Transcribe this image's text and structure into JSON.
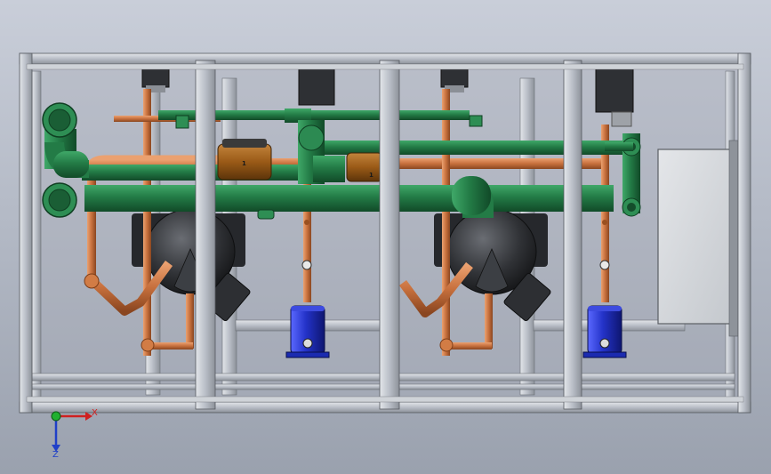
{
  "colors": {
    "frame": "#b9bec7",
    "frame_edge": "#55595f",
    "green_pipe": "#237b46",
    "copper_pipe": "#c7703d",
    "receiver_blue": "#2332c8",
    "compressor_dark": "#2d2f33",
    "accumulator_brown": "#9a5a17",
    "panel": "#d5d8dc",
    "axis_x": "#d02020",
    "axis_y": "#20b030",
    "axis_z": "#2040c8"
  },
  "axis_triad": {
    "x_label": "X",
    "z_label": "Z",
    "icon": "axis-triad-icon"
  },
  "part_labels": {
    "accumulator_left": "1",
    "accumulator_right": "1"
  }
}
